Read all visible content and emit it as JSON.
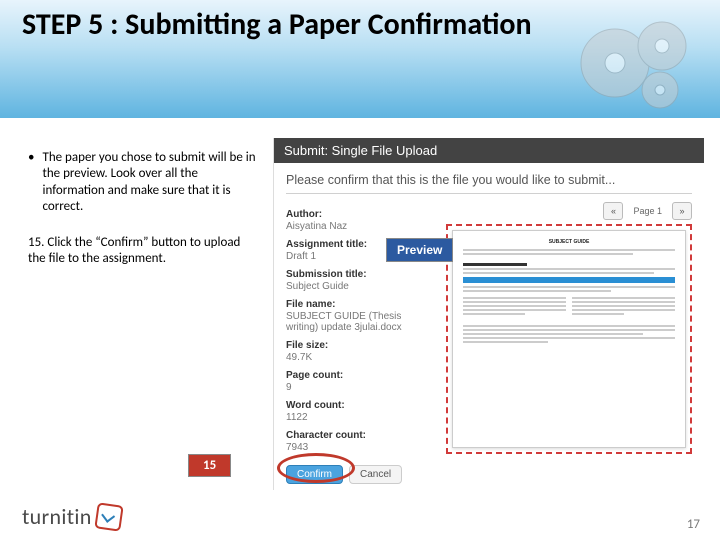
{
  "title": "STEP 5 : Submitting a Paper Confirmation",
  "left": {
    "bullet": "The paper you chose to submit will be in the preview. Look over all the information and make sure that it is correct.",
    "step15": "15. Click the “Confirm” button to upload the file to the assignment."
  },
  "panel": {
    "header": "Submit: Single File Upload",
    "message": "Please confirm that this is the file you would like to submit...",
    "meta": {
      "author_label": "Author:",
      "author": "Aisyatina Naz",
      "assignment_label": "Assignment title:",
      "assignment": "Draft 1",
      "submission_label": "Submission title:",
      "submission": "Subject Guide",
      "filename_label": "File name:",
      "filename": "SUBJECT GUIDE (Thesis writing) update 3julai.docx",
      "filesize_label": "File size:",
      "filesize": "49.7K",
      "pagecount_label": "Page count:",
      "pagecount": "9",
      "wordcount_label": "Word count:",
      "wordcount": "1122",
      "charcount_label": "Character count:",
      "charcount": "7943"
    },
    "pager": {
      "prev": "«",
      "label": "Page 1",
      "next": "»"
    },
    "preview_tag": "Preview",
    "confirm": "Confirm",
    "cancel": "Cancel"
  },
  "callout15": "15",
  "logo": "turnitin",
  "pagenum": "17"
}
